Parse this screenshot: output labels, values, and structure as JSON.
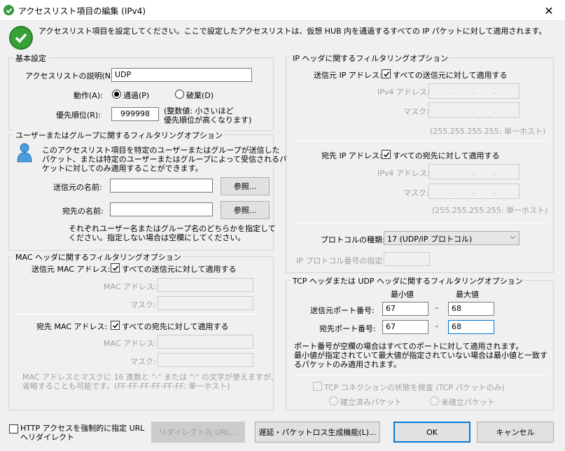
{
  "window": {
    "title": "アクセスリスト項目の編集 (IPv4)",
    "close": "✕"
  },
  "header": {
    "description": "アクセスリスト項目を設定してください。ここで設定したアクセスリストは、仮想 HUB 内を通過するすべての IP パケットに対して適用されます。"
  },
  "basic": {
    "group_label": "基本設定",
    "desc_label": "アクセスリストの説明(N):",
    "desc_value": "UDP",
    "action_label": "動作(A):",
    "action_pass": "通過(P)",
    "action_discard": "破棄(D)",
    "priority_label": "優先順位(R):",
    "priority_value": "999998",
    "priority_hint_1": "(整数値: 小さいほど",
    "priority_hint_2": "優先順位が高くなります)"
  },
  "user": {
    "group_label": "ユーザーまたはグループに関するフィルタリングオプション",
    "desc_1": "このアクセスリスト項目を特定のユーザーまたはグループが送信した",
    "desc_2": "パケット、または特定のユーザーまたはグループによって受信されるパ",
    "desc_3": "ケットに対してのみ適用することができます。",
    "src_label": "送信元の名前:",
    "dst_label": "宛先の名前:",
    "browse": "参照...",
    "note_1": "それぞれユーザー名またはグループ名のどちらかを指定して",
    "note_2": "ください。指定しない場合は空欄にしてください。"
  },
  "mac": {
    "group_label": "MAC ヘッダに関するフィルタリングオプション",
    "src_label": "送信元 MAC アドレス:",
    "src_all": "すべての送信元に対して適用する",
    "addr_label": "MAC アドレス:",
    "mask_label": "マスク:",
    "dst_label": "宛先 MAC アドレス:",
    "dst_all": "すべての宛先に対して適用する",
    "note_1": "MAC アドレスとマスクに 16 進数と \"-\" または \":\" の文字が使えますが、",
    "note_2": "省略することも可能です。(FF-FF-FF-FF-FF-FF: 単一ホスト)"
  },
  "ip": {
    "group_label": "IP ヘッダに関するフィルタリングオプション",
    "src_label": "送信元 IP アドレス:",
    "src_all": "すべての送信元に対して適用する",
    "ipv4_label": "IPv4 アドレス:",
    "mask_label": "マスク:",
    "single_host": "(255.255.255.255: 単一ホスト)",
    "dst_label": "宛先 IP アドレス:",
    "dst_all": "すべての宛先に対して適用する",
    "proto_label": "プロトコルの種類:",
    "proto_value": "17 (UDP/IP プロトコル)",
    "proto_num_label": "IP プロトコル番号の指定:",
    "dot": "."
  },
  "tcp": {
    "group_label": "TCP ヘッダまたは UDP ヘッダに関するフィルタリングオプション",
    "min": "最小値",
    "max": "最大値",
    "src_port_label": "送信元ポート番号:",
    "src_min": "67",
    "src_max": "68",
    "dst_port_label": "宛先ポート番号:",
    "dst_min": "67",
    "dst_max": "68",
    "dash": "-",
    "note_1": "ポート番号が空欄の場合はすべてのポートに対して適用されます。",
    "note_2": "最小値が指定されていて最大値が指定されていない場合は最小値と一致す",
    "note_3": "るパケットのみ適用されます。",
    "state_check": "TCP コネクションの状態を検査 (TCP パケットのみ)",
    "established": "確立済みパケット",
    "unestablished": "未確立パケット"
  },
  "footer": {
    "http_redirect_1": "HTTP アクセスを強制的に指定 URL",
    "http_redirect_2": "へリダイレクト",
    "redirect_btn": "リダイレクト先 URL...",
    "delay_btn": "遅延・パケットロス生成機能(L)...",
    "ok": "OK",
    "cancel": "キャンセル"
  },
  "colors": {
    "accent": "#0078d7",
    "check_green": "#3c9a3c"
  }
}
